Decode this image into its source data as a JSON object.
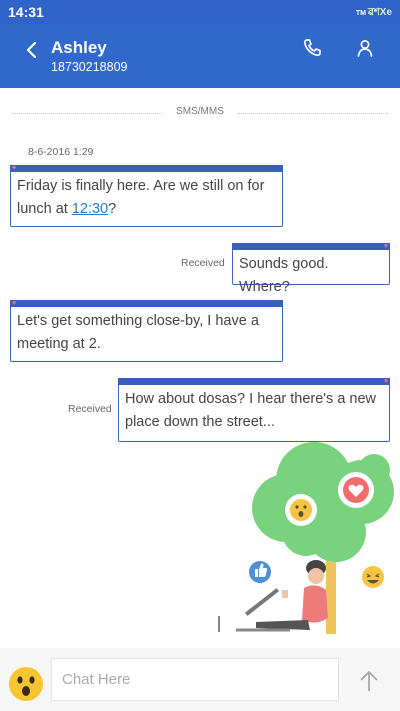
{
  "status_bar": {
    "time": "14:31",
    "brand_tm": "TM",
    "brand": "ৱশXe"
  },
  "header": {
    "contact_name": "Ashley",
    "phone_number": "18730218809",
    "icons": [
      "back-arrow-icon",
      "phone-icon",
      "person-icon"
    ]
  },
  "conversation": {
    "divider_label": "SMS/MMS",
    "date": "8-6-2016 1:29",
    "messages": [
      {
        "direction": "incoming",
        "text_before_link": "Friday is finally here. Are we still on for lunch at ",
        "link": "12:30",
        "text_after_link": "?"
      },
      {
        "direction": "outgoing",
        "status": "Received",
        "text": "Sounds good. Where?"
      },
      {
        "direction": "incoming",
        "text": "Let's get something close-by, I have a meeting at 2."
      },
      {
        "direction": "outgoing",
        "status": "Received",
        "text": "How about dosas? I hear there's a new place down the street..."
      }
    ]
  },
  "composer": {
    "placeholder": "Chat Here",
    "emoji_icon": "surprised-emoji-icon",
    "send_icon": "send-arrow-icon"
  },
  "colors": {
    "header": "#3168cc",
    "bubble_border": "#3f66b4",
    "link": "#2a79c9",
    "tree": "#79d37e",
    "heart": "#ff6d8a"
  }
}
